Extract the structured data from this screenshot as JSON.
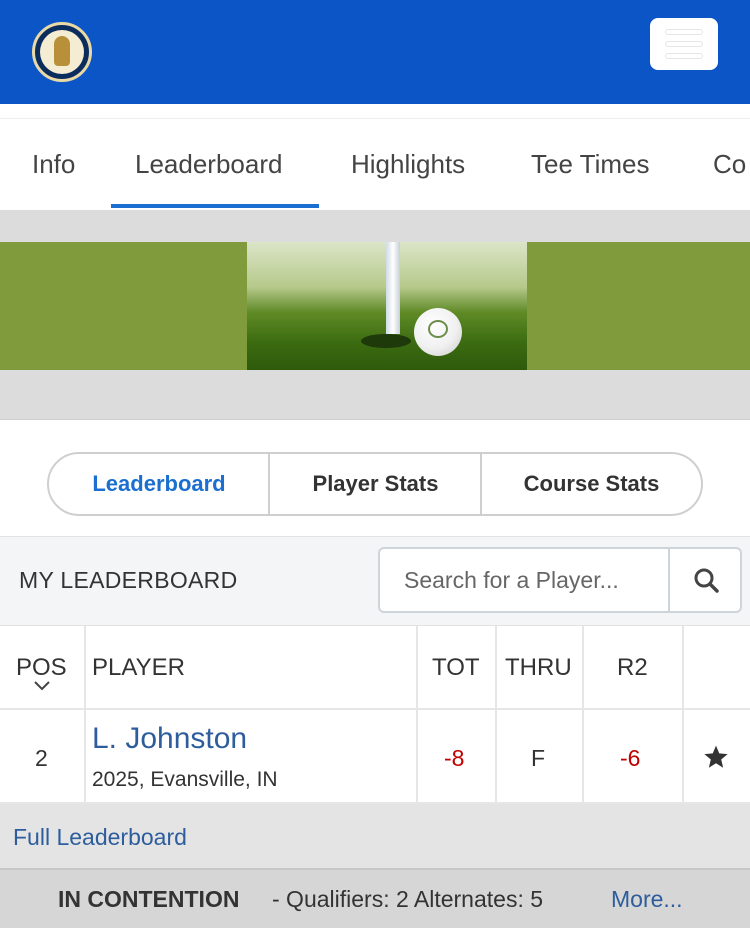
{
  "header": {
    "logo_icon": "golf-foundation-logo-icon",
    "menu_icon": "hamburger-icon",
    "brand_color": "#0c55c6"
  },
  "tabs": [
    {
      "label": "Info"
    },
    {
      "label": "Leaderboard"
    },
    {
      "label": "Highlights"
    },
    {
      "label": "Tee Times"
    },
    {
      "label": "Co"
    }
  ],
  "banner": {
    "image_icon": "golf-ball-hole-photo"
  },
  "segments": [
    {
      "label": "Leaderboard"
    },
    {
      "label": "Player Stats"
    },
    {
      "label": "Course Stats"
    }
  ],
  "my_leaderboard": {
    "title": "MY LEADERBOARD",
    "search_placeholder": "Search for a Player...",
    "search_icon": "search-icon"
  },
  "table": {
    "columns": {
      "pos": "POS",
      "player": "PLAYER",
      "tot": "TOT",
      "thru": "THRU",
      "r2": "R2"
    },
    "rows": [
      {
        "pos": "2",
        "name": "L. Johnston",
        "sub": "2025, Evansville, IN",
        "tot": "-8",
        "thru": "F",
        "r2": "-6",
        "favorite_icon": "star-icon"
      }
    ]
  },
  "full_leaderboard": "Full Leaderboard",
  "contention": {
    "title": "IN CONTENTION",
    "details": "- Qualifiers: 2  Alternates: 5",
    "more": "More..."
  },
  "colors": {
    "link": "#2d5d9c",
    "accent": "#1a6fd0",
    "negative": "#c00000"
  }
}
